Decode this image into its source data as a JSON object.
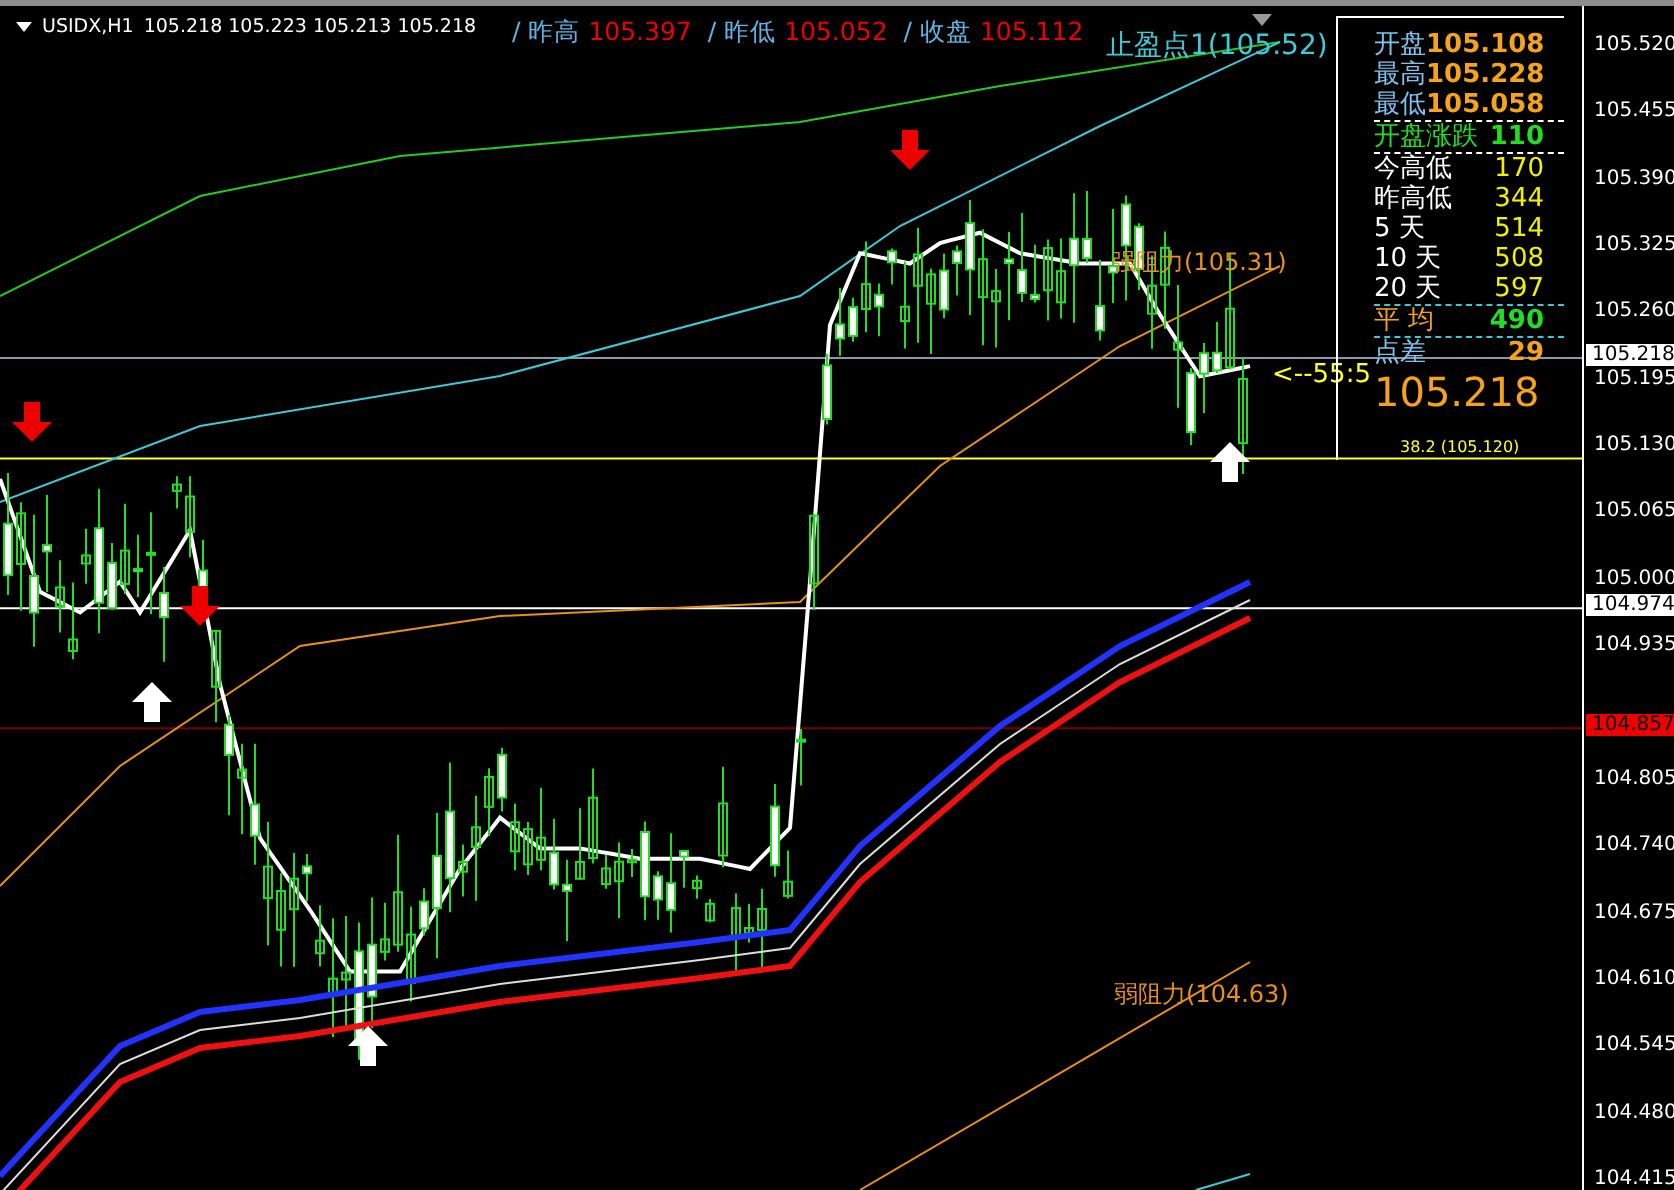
{
  "header": {
    "symbol": "USIDX,H1",
    "prices": [
      "105.218",
      "105.223",
      "105.213",
      "105.218"
    ]
  },
  "prev_day": [
    {
      "label": "/ 昨高",
      "value": "105.397"
    },
    {
      "label": "/ 昨低",
      "value": "105.052"
    },
    {
      "label": "/ 收盘",
      "value": "105.112"
    }
  ],
  "chart_labels": [
    {
      "kind": "take_profit",
      "text": "止盈点1(105.52)"
    },
    {
      "kind": "strong_resistance",
      "text": "强阻力(105.31)"
    },
    {
      "kind": "pointer",
      "text": "<--55:5"
    },
    {
      "kind": "fib",
      "text": "38.2 (105.120)"
    },
    {
      "kind": "weak_resistance",
      "text": "弱阻力(104.63)"
    }
  ],
  "info_panel": {
    "rows": [
      {
        "kind": "ohlc",
        "label": "开盘",
        "value": "105.108"
      },
      {
        "kind": "ohlc",
        "label": "最高",
        "value": "105.228"
      },
      {
        "kind": "ohlc",
        "label": "最低",
        "value": "105.058"
      },
      {
        "kind": "change",
        "label": "开盘涨跌",
        "value": "110"
      },
      {
        "kind": "range",
        "label": "今高低",
        "value": "170"
      },
      {
        "kind": "range",
        "label": "昨高低",
        "value": "344"
      },
      {
        "kind": "range",
        "label": "5 天",
        "value": "514"
      },
      {
        "kind": "range",
        "label": "10 天",
        "value": "508"
      },
      {
        "kind": "range",
        "label": "20 天",
        "value": "597"
      },
      {
        "kind": "average",
        "label": "平 均",
        "value": "490"
      }
    ],
    "spread": {
      "label": "点差",
      "value": "29"
    },
    "bid": "105.218"
  },
  "price_axis": {
    "ticks": [
      "105.520",
      "105.455",
      "105.390",
      "105.325",
      "105.260",
      "105.195",
      "105.130",
      "105.065",
      "105.000",
      "104.935",
      "104.805",
      "104.740",
      "104.675",
      "104.610",
      "104.545",
      "104.480",
      "104.415"
    ],
    "tags": [
      {
        "kind": "bid",
        "text": "105.218"
      },
      {
        "kind": "level",
        "text": "104.974"
      },
      {
        "kind": "pivot",
        "text": "104.857"
      }
    ]
  }
}
